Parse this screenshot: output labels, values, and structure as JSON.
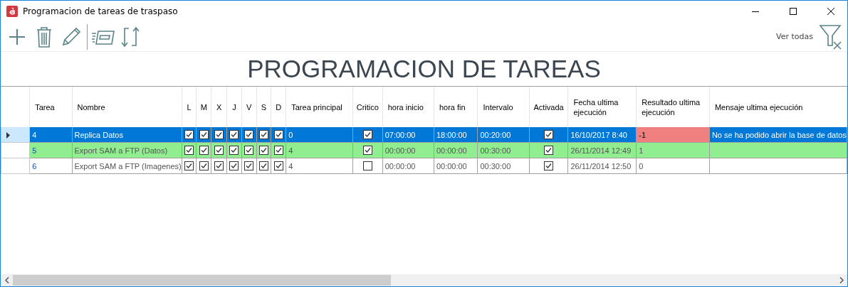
{
  "window": {
    "title": "Programacion de tareas de traspaso"
  },
  "toolbar": {
    "show_all_label": "Ver todas"
  },
  "heading": "PROGRAMACION DE TAREAS",
  "table": {
    "columns": [
      "Tarea",
      "Nombre",
      "L",
      "M",
      "X",
      "J",
      "V",
      "S",
      "D",
      "Tarea principal",
      "Critico",
      "hora inicio",
      "hora fin",
      "Intervalo",
      "Activada",
      "Fecha ultima ejecución",
      "Resultado ultima ejecución",
      "Mensaje ultima ejecución"
    ],
    "rows": [
      {
        "selected": true,
        "tarea": "4",
        "nombre": "Replica Datos",
        "days": [
          true,
          true,
          true,
          true,
          true,
          true,
          true
        ],
        "tarea_principal": "0",
        "critico": true,
        "hora_inicio": "07:00:00",
        "hora_fin": "18:00:00",
        "intervalo": "00:20:00",
        "activada": true,
        "fecha": "16/10/2017 8:40",
        "resultado": {
          "text": "-1",
          "color": "#f08080"
        },
        "mensaje": "No se ha podido abrir la base de datos"
      },
      {
        "selected": false,
        "color": "#90ee90",
        "tarea": "5",
        "nombre": "Export SAM a FTP (Datos)",
        "days": [
          true,
          true,
          true,
          true,
          true,
          true,
          true
        ],
        "tarea_principal": "4",
        "critico": true,
        "hora_inicio": "00:00:00",
        "hora_fin": "00:00:00",
        "intervalo": "00:30:00",
        "activada": true,
        "fecha": "26/11/2014 12:49",
        "resultado": {
          "text": "1"
        }
      },
      {
        "selected": false,
        "color": "#ffffff",
        "tarea": "6",
        "nombre": "Export SAM a FTP (Imagenes)",
        "days": [
          true,
          true,
          true,
          true,
          true,
          true,
          true
        ],
        "tarea_principal": "4",
        "critico": false,
        "hora_inicio": "00:00:00",
        "hora_fin": "00:00:00",
        "intervalo": "00:30:00",
        "activada": true,
        "fecha": "26/11/2014 12:50",
        "resultado": {
          "text": "0"
        }
      }
    ]
  }
}
